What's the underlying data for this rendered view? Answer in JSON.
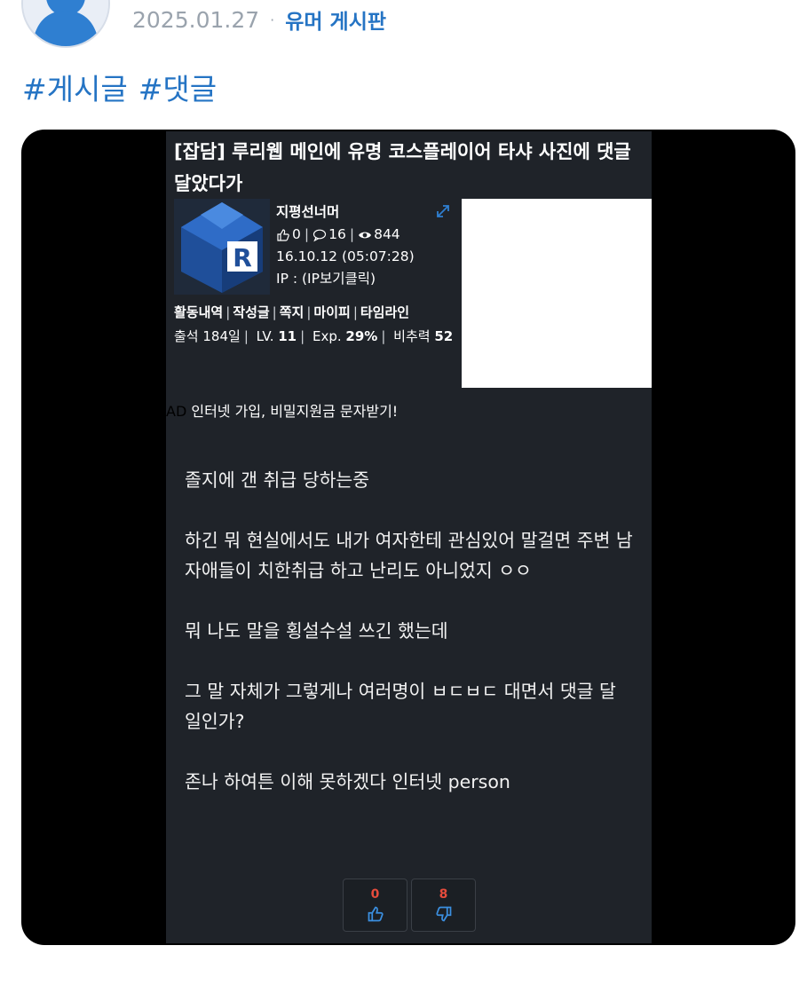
{
  "post": {
    "date": "2025.01.27",
    "separator": "·",
    "board": "유머 게시판",
    "tags": [
      "#게시글",
      "#댓글"
    ]
  },
  "screenshot": {
    "title": "[잡담] 루리웹 메인에 유명 코스플레이어 타샤 사진에 댓글 달았다가",
    "author": {
      "name": "지평선너머",
      "likes": "0",
      "comments": "16",
      "views": "844",
      "datetime": "16.10.12 (05:07:28)",
      "ip": "IP : (IP보기클릭)"
    },
    "user_links": [
      "활동내역",
      "작성글",
      "쪽지",
      "마이피",
      "타임라인"
    ],
    "user_stats": {
      "attendance": "출석 184일",
      "level_label": "LV.",
      "level": "11",
      "exp_label": "Exp.",
      "exp": "29%",
      "power_label": "비추력",
      "power": "52"
    },
    "ad": {
      "tag": "AD",
      "text": "인터넷 가입, 비밀지원금 문자받기!"
    },
    "body": [
      "졸지에 갠 취급 당하는중",
      "하긴 뭐 현실에서도 내가 여자한테 관심있어 말걸면 주변 남자애들이 치한취급 하고 난리도 아니었지 ㅇㅇ",
      "뭐 나도 말을 횡설수설 쓰긴 했는데",
      "그 말 자체가 그렇게나 여러명이 ㅂㄷㅂㄷ 대면서 댓글 달 일인가?",
      "존나 하여튼 이해 못하겠다 인터넷 person"
    ],
    "votes": {
      "up": "0",
      "down": "8"
    }
  },
  "colors": {
    "accent": "#2574c4",
    "date": "#9aa3ad",
    "frame": "#000000",
    "screenshot_bg": "#1f2329",
    "vote_count": "#e74c3c",
    "vote_icon": "#3b8fe0"
  },
  "icons": [
    "avatar-person-icon",
    "ruliweb-r-logo",
    "thumbs-up-icon",
    "comment-icon",
    "eye-icon",
    "expand-icon",
    "thumbs-down-icon"
  ]
}
